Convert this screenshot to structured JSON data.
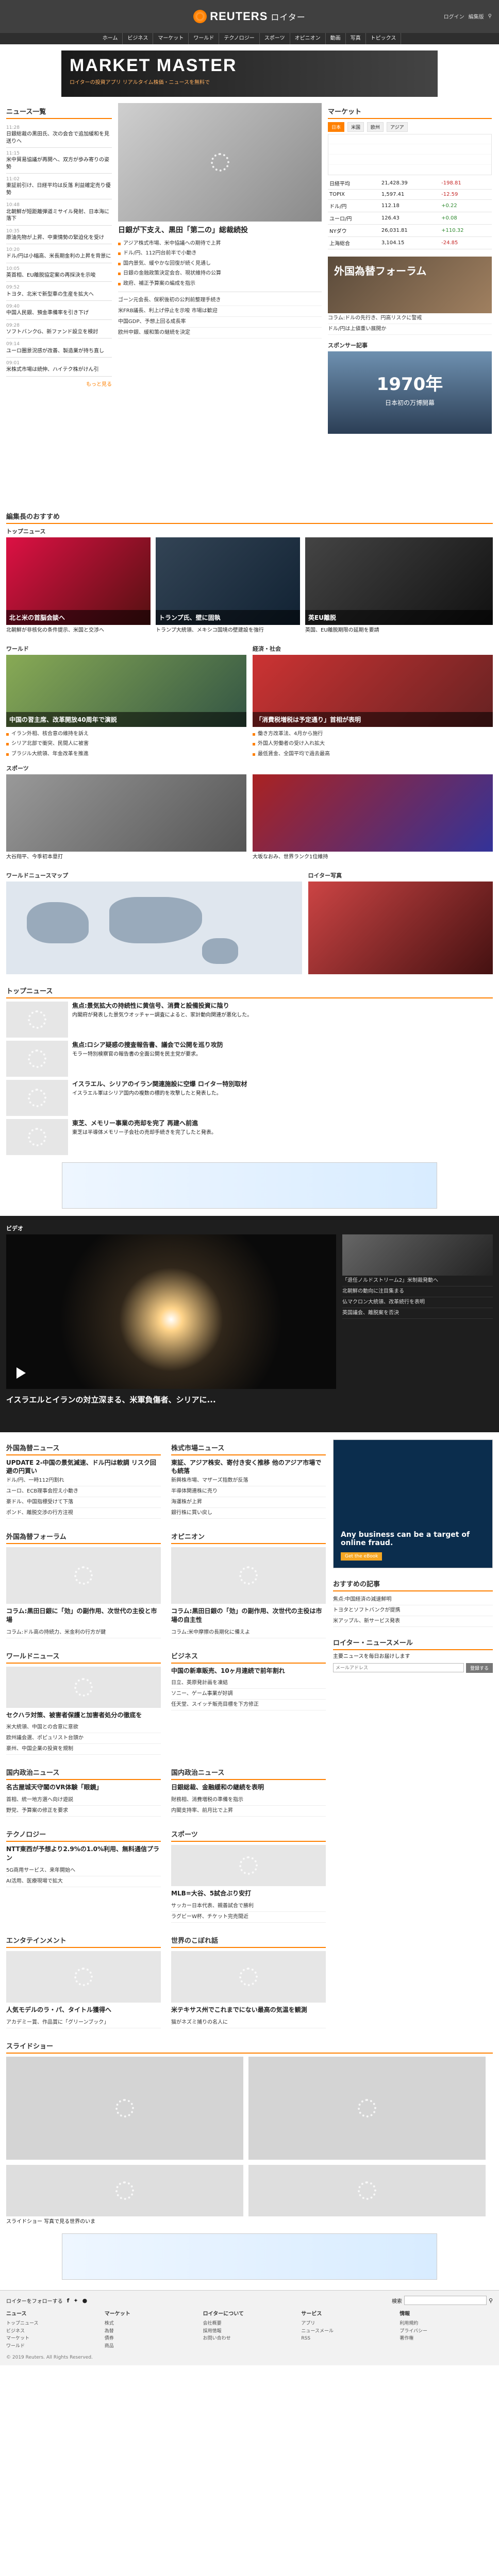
{
  "header": {
    "brand": "REUTERS",
    "brand_jp": "ロイター",
    "util": [
      "ログイン",
      "編集版",
      "検索"
    ]
  },
  "nav": [
    "ホーム",
    "ビジネス",
    "マーケット",
    "ワールド",
    "テクノロジー",
    "スポーツ",
    "オピニオン",
    "動画",
    "写真",
    "トピックス"
  ],
  "banner": {
    "title": "MARKET MASTER",
    "sub": "ロイターの投資アプリ リアルタイム株価・ニュースを無料で"
  },
  "news_section": {
    "title": "ニュース一覧",
    "items": [
      {
        "time": "11:28",
        "text": "日銀総裁の黒田氏、次の会合で追加緩和を見送りへ"
      },
      {
        "time": "11:15",
        "text": "米中貿易協議が再開へ、双方が歩み寄りの姿勢"
      },
      {
        "time": "11:02",
        "text": "東証前引け、日経平均は反落 利益確定売り優勢"
      },
      {
        "time": "10:48",
        "text": "北朝鮮が短距離弾道ミサイル発射、日本海に落下"
      },
      {
        "time": "10:35",
        "text": "原油先物が上昇、中東情勢の緊迫化を受け"
      },
      {
        "time": "10:20",
        "text": "ドル/円は小幅高、米長期金利の上昇を背景に"
      },
      {
        "time": "10:05",
        "text": "英首相、EU離脱協定案の再採決を示唆"
      },
      {
        "time": "09:52",
        "text": "トヨタ、北米で新型車の生産を拡大へ"
      },
      {
        "time": "09:40",
        "text": "中国人民銀、預金準備率を引き下げ"
      },
      {
        "time": "09:28",
        "text": "ソフトバンクG、新ファンド設立を検討"
      },
      {
        "time": "09:14",
        "text": "ユーロ圏景況感が改善、製造業が持ち直し"
      },
      {
        "time": "09:01",
        "text": "米株式市場は続伸、ハイテク株がけん引"
      }
    ],
    "more": "もっと見る"
  },
  "lead": {
    "headline": "日銀が下支え、黒田「第二の」総裁続投",
    "bullets": [
      "アジア株式市場、米中協議への期待で上昇",
      "ドル/円、112円台前半で小動き",
      "国内景気、緩やかな回復が続く見通し",
      "日銀の金融政策決定会合、現状維持の公算",
      "政府、補正予算案の編成を指示"
    ],
    "stories": [
      "ゴーン元会長、保釈後初の公判前整理手続き",
      "米FRB議長、利上げ停止を示唆 市場は歓迎",
      "中国GDP、予想上回る成長率",
      "欧州中銀、緩和策の継続を決定"
    ]
  },
  "market": {
    "title": "マーケット",
    "tabs": [
      "日本",
      "米国",
      "欧州",
      "アジア"
    ],
    "rows": [
      {
        "name": "日経平均",
        "value": "21,428.39",
        "chg": "-198.81",
        "dir": "dn"
      },
      {
        "name": "TOPIX",
        "value": "1,597.41",
        "chg": "-12.59",
        "dir": "dn"
      },
      {
        "name": "ドル/円",
        "value": "112.18",
        "chg": "+0.22",
        "dir": "up"
      },
      {
        "name": "ユーロ/円",
        "value": "126.43",
        "chg": "+0.08",
        "dir": "up"
      },
      {
        "name": "NYダウ",
        "value": "26,031.81",
        "chg": "+110.32",
        "dir": "up"
      },
      {
        "name": "上海総合",
        "value": "3,104.15",
        "chg": "-24.85",
        "dir": "dn"
      }
    ]
  },
  "forum": {
    "title": "外国為替フォーラム",
    "items": [
      "コラム:ドルの先行き、円高リスクに警戒",
      "ドル/円は上値重い展開か"
    ]
  },
  "promo": {
    "title": "スポンサー記事",
    "year": "1970年",
    "sub": "日本初の万博開幕"
  },
  "editor": {
    "title": "編集長のおすすめ"
  },
  "top_news": {
    "title": "トップニュース",
    "cards": [
      {
        "cap": "北朝鮮が非核化の条件提示、米国と交渉へ",
        "overlay": "北と米の首脳会談へ"
      },
      {
        "cap": "トランプ大統領、メキシコ国境の壁建設を強行",
        "overlay": "トランプ氏、壁に固執"
      },
      {
        "cap": "英国、EU離脱期限の延期を要請",
        "overlay": "英EU離脱"
      }
    ]
  },
  "world": {
    "title": "ワールド",
    "headline": "中国の習主席、改革開放40周年で演説",
    "bullets": [
      "イラン外相、核合意の維持を訴え",
      "シリア北部で衝突、民間人に被害",
      "ブラジル大統領、年金改革を推進"
    ]
  },
  "economy": {
    "title": "経済・社会",
    "headline": "「消費税増税は予定通り」首相が表明",
    "bullets": [
      "働き方改革法、4月から施行",
      "外国人労働者の受け入れ拡大",
      "最低賃金、全国平均で過去最高"
    ]
  },
  "sports": {
    "title": "スポーツ",
    "items": [
      {
        "cap": "大谷翔平、今季初本塁打"
      },
      {
        "cap": "大坂なおみ、世界ランク1位維持"
      }
    ]
  },
  "world_news_map": {
    "title": "ワールドニュースマップ"
  },
  "reuters_photo": {
    "title": "ロイター写真"
  },
  "topnews2": {
    "title": "トップニュース",
    "items": [
      {
        "t": "焦点:景気拡大の持続性に黄信号、消費と設備投資に陰り",
        "s": "内閣府が発表した景気ウオッチャー調査によると、家計動向関連が悪化した。"
      },
      {
        "t": "焦点:ロシア疑惑の捜査報告書、議会で公開を巡り攻防",
        "s": "モラー特別検察官の報告書の全面公開を民主党が要求。"
      },
      {
        "t": "イスラエル、シリアのイラン関連施設に空爆 ロイター特別取材",
        "s": "イスラエル軍はシリア国内の複数の標的を攻撃したと発表した。"
      },
      {
        "t": "東芝、メモリー事業の売却を完了 再建へ前進",
        "s": "東芝は半導体メモリー子会社の売却手続きを完了したと発表。"
      }
    ]
  },
  "video": {
    "title": "ビデオ",
    "caption": "イスラエルとイランの対立深まる、米軍負傷者、シリアに...",
    "side": [
      "「退任ノルドストリーム2」米制裁発動へ",
      "北朝鮮の動向に注目集まる",
      "仏マクロン大統領、改革続行を表明",
      "英国議会、離脱案を否決"
    ]
  },
  "fx": {
    "title": "外国為替ニュース",
    "head": "UPDATE 2-中国の景気減速、ドル円は軟調 リスク回避の円買い",
    "items": [
      "ドル/円、一時112円割れ",
      "ユーロ、ECB理事会控え小動き",
      "豪ドル、中国指標受けて下落",
      "ポンド、離脱交渉の行方注視"
    ]
  },
  "stock": {
    "title": "株式市場ニュース",
    "head": "東証、アジア株安、寄付き安く推移 他のアジア市場でも続落",
    "items": [
      "新興株市場、マザーズ指数が反落",
      "半導体関連株に売り",
      "海運株が上昇",
      "銀行株に買い戻し"
    ]
  },
  "sidebar": {
    "ad_text": "Any business can be a target of online fraud.",
    "ad_btn": "Get the eBook",
    "ranking": "おすすめの記事",
    "rank_items": [
      "焦点:中国経済の減速鮮明",
      "トヨタとソフトバンクが提携",
      "米アップル、新サービス発表"
    ],
    "newsletter": "ロイター・ニュースメール",
    "nl_text": "主要ニュースを毎日お届けします",
    "nl_placeholder": "メールアドレス",
    "nl_btn": "登録する"
  },
  "fx_forum": {
    "title": "外国為替フォーラム",
    "items": [
      {
        "t": "コラム:黒田日銀に「効」の副作用、次世代の主役と市場"
      },
      {
        "t": "コラム:ドル高の持続力、米金利の行方が鍵"
      }
    ]
  },
  "opinion": {
    "title": "オピニオン",
    "items": [
      {
        "t": "コラム:黒田日銀の「効」の副作用、次世代の主役は市場の自主性"
      },
      {
        "t": "コラム:米中摩擦の長期化に備えよ"
      }
    ]
  },
  "world_news": {
    "title": "ワールドニュース",
    "items": [
      "セクハラ対策、被害者保護と加害者処分の徹底を",
      "米大統領、中国との合意に意欲",
      "欧州議会選、ポピュリスト台頭か",
      "豪州、中国企業の投資を規制"
    ]
  },
  "business": {
    "title": "ビジネス",
    "items": [
      "中国の新車販売、10ヶ月連続で前年割れ",
      "日立、英原発計画を凍結",
      "ソニー、ゲーム事業が好調",
      "任天堂、スイッチ販売目標を下方修正"
    ]
  },
  "politics": {
    "title": "国内政治ニュース",
    "head": "名古屋城天守閣のVR体験「眼鏡」",
    "items": [
      "首相、統一地方選へ向け遊説",
      "野党、予算案の修正を要求"
    ]
  },
  "politics2": {
    "title": "国内政治ニュース",
    "head": "日銀総裁、金融緩和の継続を表明",
    "items": [
      "財務相、消費増税の準備を指示",
      "内閣支持率、前月比で上昇"
    ]
  },
  "tech": {
    "title": "テクノロジー",
    "head": "NTT東西が予想より2.9%の1.0%利用、無料通信プラン",
    "items": [
      "5G商用サービス、来年開始へ",
      "AI活用、医療現場で拡大"
    ]
  },
  "sport2": {
    "title": "スポーツ",
    "head": "MLB=大谷、5試合ぶり安打",
    "items": [
      "サッカー日本代表、親善試合で勝利",
      "ラグビーW杯、チケット完売間近"
    ]
  },
  "ent": {
    "title": "エンタテインメント",
    "items": [
      "人気モデルのラ・パ、タイトル獲得へ",
      "アカデミー賞、作品賞に「グリーンブック」"
    ]
  },
  "odd": {
    "title": "世界のこぼれ話",
    "items": [
      "米テキサス州でこれまでにない最高の気温を観測",
      "猫がネズミ捕りの名人に"
    ]
  },
  "slideshow": {
    "title": "スライドショー",
    "caption": "スライドショー 写真で見る世界のいま"
  },
  "footer": {
    "social": "ロイターをフォローする",
    "search": "検索",
    "cols": [
      {
        "h": "ニュース",
        "items": [
          "トップニュース",
          "ビジネス",
          "マーケット",
          "ワールド"
        ]
      },
      {
        "h": "マーケット",
        "items": [
          "株式",
          "為替",
          "債券",
          "商品"
        ]
      },
      {
        "h": "ロイターについて",
        "items": [
          "会社概要",
          "採用情報",
          "お問い合わせ"
        ]
      },
      {
        "h": "サービス",
        "items": [
          "アプリ",
          "ニュースメール",
          "RSS"
        ]
      },
      {
        "h": "情報",
        "items": [
          "利用規約",
          "プライバシー",
          "著作権"
        ]
      }
    ],
    "copy": "© 2019 Reuters. All Rights Reserved."
  }
}
